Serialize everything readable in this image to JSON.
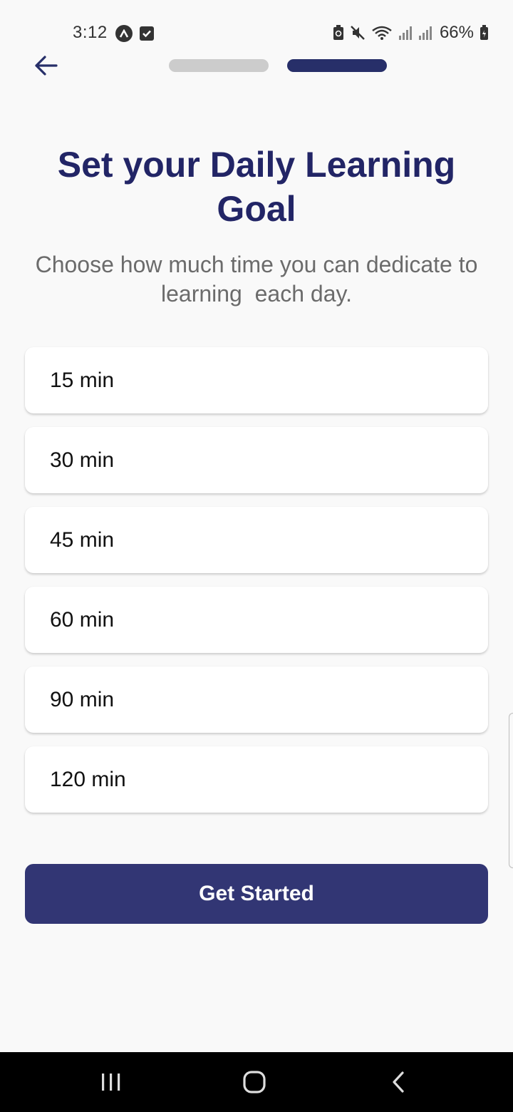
{
  "status_bar": {
    "time": "3:12",
    "battery": "66%",
    "icons": [
      "app-circle-icon",
      "checkbox-icon",
      "battery-saver-icon",
      "mute-icon",
      "wifi-icon",
      "signal-icon",
      "signal-icon",
      "battery-icon"
    ]
  },
  "header": {
    "back_icon": "arrow-left-icon",
    "progress": {
      "total_steps": 2,
      "current_step": 2
    }
  },
  "main": {
    "title": "Set your Daily Learning Goal",
    "subtitle": "Choose how much time you can dedicate to learning  each day.",
    "options": [
      {
        "label": "15 min"
      },
      {
        "label": "30 min"
      },
      {
        "label": "45 min"
      },
      {
        "label": "60 min"
      },
      {
        "label": "90 min"
      },
      {
        "label": "120 min"
      }
    ],
    "cta_label": "Get Started"
  },
  "colors": {
    "primary": "#272f69",
    "button": "#323674",
    "title": "#222566",
    "subtitle": "#6b6b6b",
    "inactive_step": "#cccccc",
    "background": "#f9f9f9"
  },
  "nav_bar": {
    "icons": [
      "recents-icon",
      "home-icon",
      "back-icon"
    ]
  }
}
